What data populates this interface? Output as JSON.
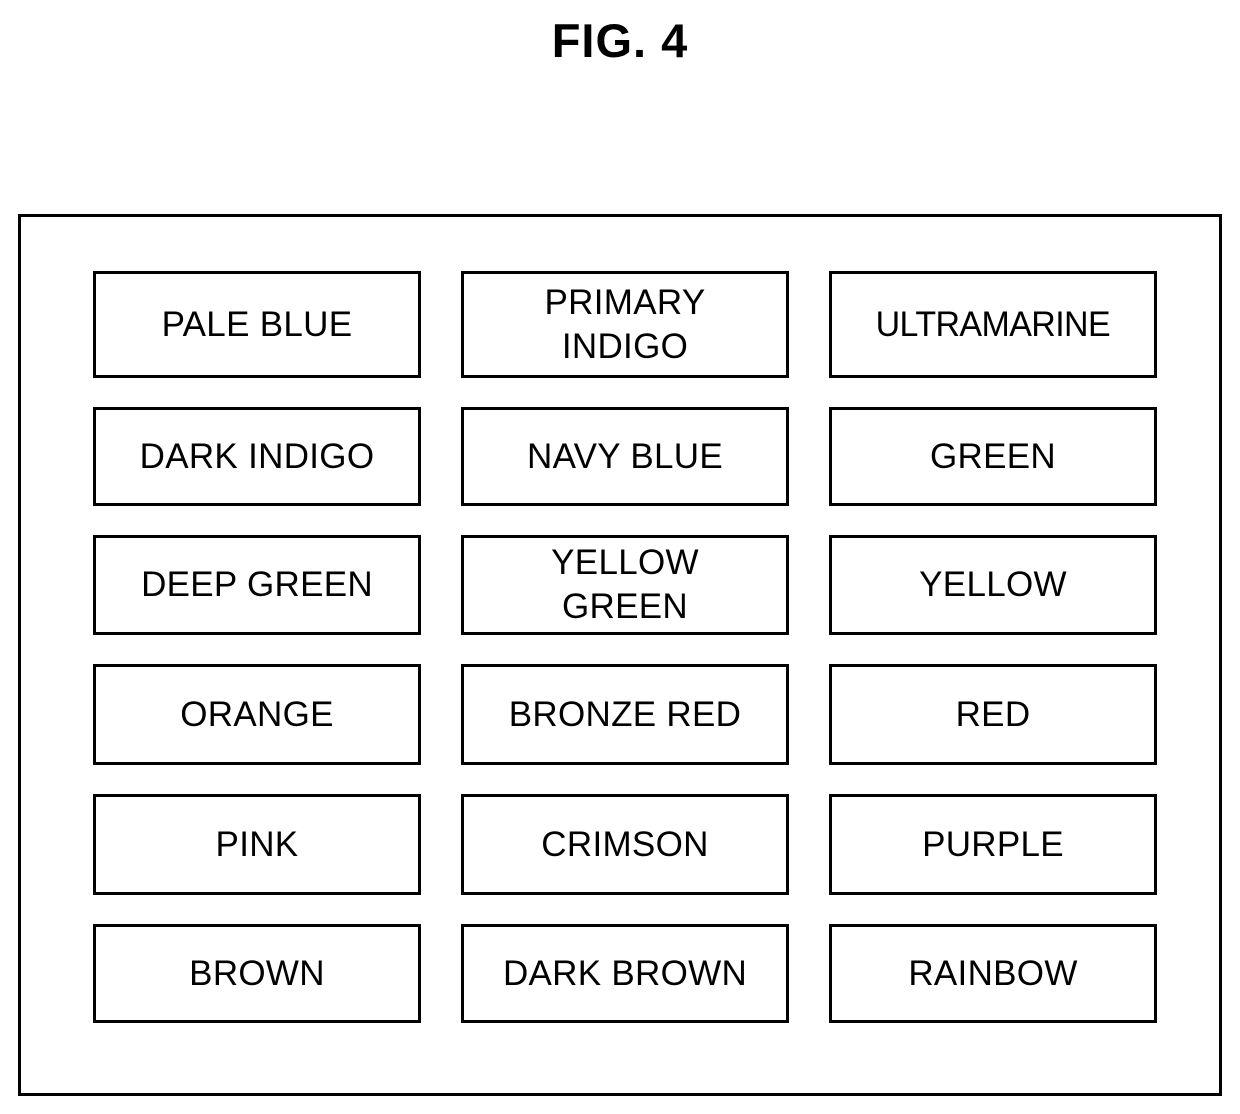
{
  "figure": {
    "title": "FIG. 4"
  },
  "diagram": {
    "kind": "color-option-table",
    "columns": 3,
    "rows": 6,
    "border_color": "#000000",
    "background_color": "#ffffff",
    "boxes": [
      {
        "label": "PALE BLUE",
        "lines": 1
      },
      {
        "label": "PRIMARY\nINDIGO",
        "lines": 2
      },
      {
        "label": "ULTRAMARINE",
        "lines": 1
      },
      {
        "label": "DARK INDIGO",
        "lines": 1
      },
      {
        "label": "NAVY BLUE",
        "lines": 1
      },
      {
        "label": "GREEN",
        "lines": 1
      },
      {
        "label": "DEEP GREEN",
        "lines": 1
      },
      {
        "label": "YELLOW\nGREEN",
        "lines": 2
      },
      {
        "label": "YELLOW",
        "lines": 1
      },
      {
        "label": "ORANGE",
        "lines": 1
      },
      {
        "label": "BRONZE RED",
        "lines": 1
      },
      {
        "label": "RED",
        "lines": 1
      },
      {
        "label": "PINK",
        "lines": 1
      },
      {
        "label": "CRIMSON",
        "lines": 1
      },
      {
        "label": "PURPLE",
        "lines": 1
      },
      {
        "label": "BROWN",
        "lines": 1
      },
      {
        "label": "DARK BROWN",
        "lines": 1
      },
      {
        "label": "RAINBOW",
        "lines": 1
      }
    ]
  }
}
